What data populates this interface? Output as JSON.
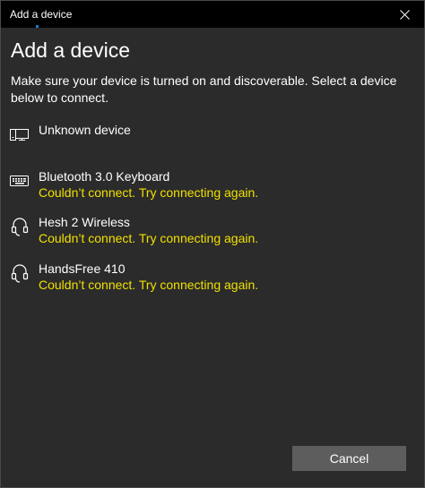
{
  "window": {
    "title": "Add a device",
    "close_glyph": "✕"
  },
  "heading": "Add a device",
  "description": "Make sure your device is turned on and discoverable. Select a device below to connect.",
  "devices": [
    {
      "name": "Unknown device",
      "status": "",
      "icon": "display-device-icon"
    },
    {
      "name": "Bluetooth 3.0 Keyboard",
      "status": "Couldn’t connect. Try connecting again.",
      "icon": "keyboard-icon"
    },
    {
      "name": "Hesh 2 Wireless",
      "status": "Couldn’t connect. Try connecting again.",
      "icon": "headset-icon"
    },
    {
      "name": "HandsFree 410",
      "status": "Couldn’t connect. Try connecting again.",
      "icon": "headset-icon"
    }
  ],
  "buttons": {
    "cancel": "Cancel"
  },
  "colors": {
    "background": "#2b2b2b",
    "titlebar": "#000000",
    "status_text": "#f0e000",
    "button": "#5d5d5d",
    "accent": "#1e7bd6"
  }
}
